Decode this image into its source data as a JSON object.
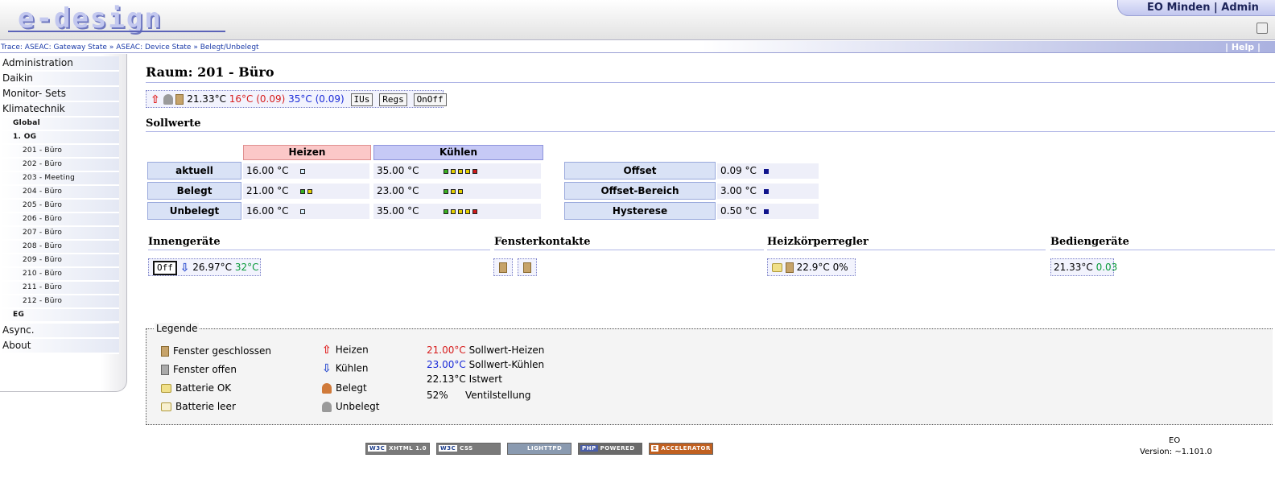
{
  "header": {
    "logo": "e-design",
    "user": "EO Minden | Admin"
  },
  "trace": {
    "prefix": "Trace:",
    "items": [
      "ASEAC: Gateway State",
      "ASEAC: Device State",
      "Belegt/Unbelegt"
    ],
    "sep": "»",
    "help": "| Help |"
  },
  "sidebar": {
    "items": [
      {
        "label": "Administration"
      },
      {
        "label": "Daikin"
      },
      {
        "label": "Monitor- Sets"
      },
      {
        "label": "Klimatechnik"
      }
    ],
    "sub": [
      {
        "label": "Global"
      },
      {
        "label": "1. OG"
      }
    ],
    "rooms": [
      {
        "label": "201 - Büro"
      },
      {
        "label": "202 - Büro"
      },
      {
        "label": "203 - Meeting"
      },
      {
        "label": "204 - Büro"
      },
      {
        "label": "205 - Büro"
      },
      {
        "label": "206 - Büro"
      },
      {
        "label": "207 - Büro"
      },
      {
        "label": "208 - Büro"
      },
      {
        "label": "209 - Büro"
      },
      {
        "label": "210 - Büro"
      },
      {
        "label": "211 - Büro"
      },
      {
        "label": "212 - Büro"
      }
    ],
    "eg": "EG",
    "bottom": [
      {
        "label": "Async. Sensors/Actuators"
      },
      {
        "label": "About"
      }
    ]
  },
  "room": {
    "title": "Raum: 201 - Büro",
    "ist": "21.33°C",
    "heat": "16°C (0.09)",
    "cool": "35°C (0.09)",
    "btn_ius": "IUs",
    "btn_regs": "Regs",
    "btn_onoff": "OnOff"
  },
  "sollwerte": {
    "title": "Sollwerte",
    "heizen": "Heizen",
    "kuehlen": "Kühlen",
    "rows": [
      {
        "label": "aktuell",
        "heat": "16.00 °C",
        "cool": "35.00 °C"
      },
      {
        "label": "Belegt",
        "heat": "21.00 °C",
        "cool": "23.00 °C"
      },
      {
        "label": "Unbelegt",
        "heat": "16.00 °C",
        "cool": "35.00 °C"
      }
    ],
    "params": [
      {
        "label": "Offset",
        "value": "0.09 °C"
      },
      {
        "label": "Offset-Bereich",
        "value": "3.00 °C"
      },
      {
        "label": "Hysterese",
        "value": "0.50 °C"
      }
    ]
  },
  "innen": {
    "title": "Innengeräte",
    "btn": "Off",
    "temp": "26.97°C",
    "set": "32°C"
  },
  "fenster": {
    "title": "Fensterkontakte"
  },
  "heizk": {
    "title": "Heizkörperregler",
    "temp": "22.9°C",
    "valve": "0%"
  },
  "bedien": {
    "title": "Bediengeräte",
    "temp": "21.33°C",
    "offset": "0.03"
  },
  "legend": {
    "title": "Legende",
    "c1": [
      "Fenster geschlossen",
      "Fenster offen",
      "Batterie OK",
      "Batterie leer"
    ],
    "c2": [
      "Heizen",
      "Kühlen",
      "Belegt",
      "Unbelegt"
    ],
    "c3": [
      {
        "v": "21.00°C",
        "l": "Sollwert-Heizen"
      },
      {
        "v": "23.00°C",
        "l": "Sollwert-Kühlen"
      },
      {
        "v": "22.13°C",
        "l": "Istwert"
      },
      {
        "v": "52%",
        "l": "Ventilstellung"
      }
    ]
  },
  "badges": [
    {
      "w": "W3C",
      "t": "XHTML 1.0"
    },
    {
      "w": "W3C",
      "t": "CSS"
    },
    {
      "w": "",
      "t": "LIGHTTPD"
    },
    {
      "w": "PHP",
      "t": "POWERED"
    },
    {
      "w": "E",
      "t": "ACCELERATOR"
    }
  ],
  "footer": {
    "name": "EO",
    "version": "Version: ~1.101.0"
  },
  "colors": {
    "heat": "#d71d1d",
    "cool": "#1b2bd8",
    "ok": "#0a9a3a",
    "accent": "#b0b6e6"
  }
}
